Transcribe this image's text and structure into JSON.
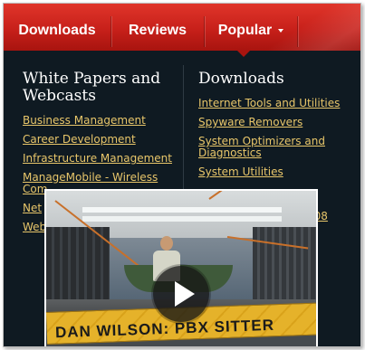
{
  "nav": {
    "tabs": [
      {
        "label": "Downloads"
      },
      {
        "label": "Reviews"
      },
      {
        "label": "Popular",
        "icon": "chevron-down-icon",
        "active": true
      }
    ]
  },
  "menu": {
    "left_column": {
      "heading": "White Papers and Webcasts",
      "links": [
        "Business Management",
        "Career Development",
        "Infrastructure Management",
        "ManageMobile - Wireless Com",
        "Net",
        "Web"
      ]
    },
    "right_column": {
      "heading": "Downloads",
      "links": [
        "Internet Tools and Utilities",
        "Spyware Removers",
        "System Optimizers and Diagnostics",
        "System Utilities",
        "008"
      ]
    }
  },
  "video": {
    "caption": "DAN WILSON: PBX SITTER",
    "play_icon": "play-icon"
  },
  "colors": {
    "nav_red": "#c7201a",
    "panel_bg": "#0f1a22",
    "link": "#e8c66a",
    "heading": "#ffffff"
  }
}
